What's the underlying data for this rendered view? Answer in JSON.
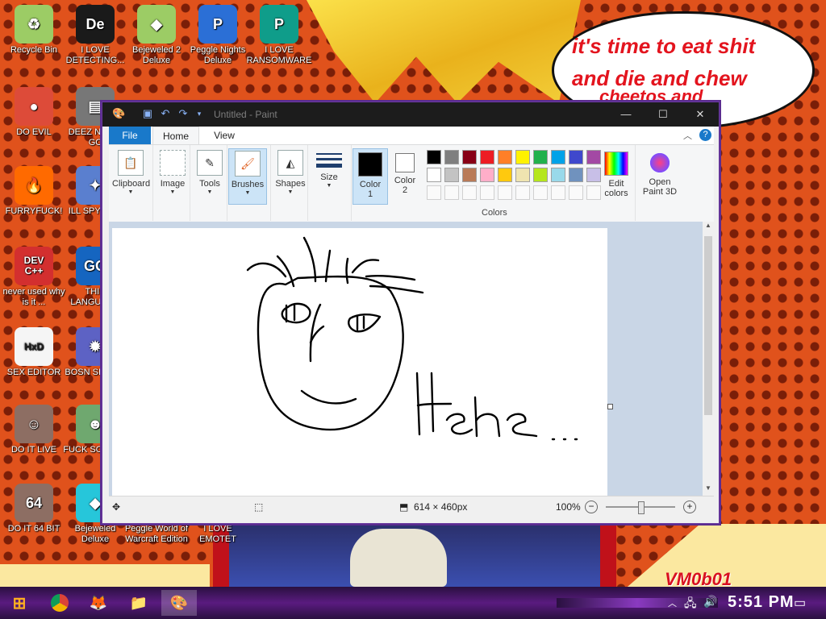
{
  "desktop": {
    "speech_lines": [
      "it's time to eat shit",
      "and die and chew",
      "cheetos and"
    ],
    "watermark": "VM0b01",
    "icons": [
      {
        "label": "Recycle Bin",
        "glyph": "♻",
        "color": "#9ccc65"
      },
      {
        "label": "I LOVE DETECTING...",
        "glyph": "De",
        "color": "#1a1a1a"
      },
      {
        "label": "Bejeweled 2 Deluxe",
        "glyph": "◆",
        "color": "#9ccc65"
      },
      {
        "label": "Peggle Nights Deluxe",
        "glyph": "P",
        "color": "#2b6fd6"
      },
      {
        "label": "I LOVE RANSOMWARE",
        "glyph": "P",
        "color": "#0f9d8a"
      },
      {
        "label": "DO EVIL",
        "glyph": "●",
        "color": "#dd4b39"
      },
      {
        "label": "DEEZ N HAH GC",
        "glyph": "▤",
        "color": "#777777"
      },
      {
        "label": "FURRYFUCK!",
        "glyph": "🔥",
        "color": "#ff6a00"
      },
      {
        "label": "ILL SPY YOU",
        "glyph": "✦",
        "color": "#5a7fcf"
      },
      {
        "label": "never used why is it ...",
        "glyph": "DEV C++",
        "color": "#d32f2f"
      },
      {
        "label": "THIS LANGUAGE",
        "glyph": "GO",
        "color": "#1565c0"
      },
      {
        "label": "SEX EDITOR",
        "glyph": "HxD",
        "color": "#f5f5f5"
      },
      {
        "label": "BOSN SIMULA",
        "glyph": "✹",
        "color": "#5d62c4"
      },
      {
        "label": "DO IT LIVE",
        "glyph": "☺",
        "color": "#8d6e63"
      },
      {
        "label": "FUCK SO ELVE",
        "glyph": "☻",
        "color": "#6fa86f"
      },
      {
        "label": "DO IT 64 BIT",
        "glyph": "64",
        "color": "#8d6e63"
      },
      {
        "label": "Bejeweled Deluxe",
        "glyph": "◆",
        "color": "#26c6da"
      },
      {
        "label": "Peggle World of Warcraft Edition",
        "glyph": "",
        "color": "#c0111a"
      },
      {
        "label": "I LOVE EMOTET",
        "glyph": "",
        "color": "#c0111a"
      }
    ]
  },
  "window": {
    "title": "Untitled - Paint",
    "controls": {
      "minimize": "—",
      "maximize": "☐",
      "close": "✕"
    },
    "menu": {
      "file": "File",
      "home": "Home",
      "view": "View"
    },
    "ribbon": {
      "clipboard": "Clipboard",
      "image": "Image",
      "tools": "Tools",
      "brushes": "Brushes",
      "shapes": "Shapes",
      "size": "Size",
      "color1": [
        "Color",
        "1"
      ],
      "color2": [
        "Color",
        "2"
      ],
      "colors_group": "Colors",
      "edit_colors": [
        "Edit",
        "colors"
      ],
      "paint3d": [
        "Open",
        "Paint 3D"
      ],
      "palette_row1": [
        "#000000",
        "#7f7f7f",
        "#880015",
        "#ed1c24",
        "#ff7f27",
        "#fff200",
        "#22b14c",
        "#00a2e8",
        "#3f48cc",
        "#a349a4"
      ],
      "palette_row2": [
        "#ffffff",
        "#c3c3c3",
        "#b97a57",
        "#ffaec9",
        "#ffc90e",
        "#efe4b0",
        "#b5e61d",
        "#99d9ea",
        "#7092be",
        "#c8bfe7"
      ],
      "color1_value": "#000000",
      "color2_value": "#ffffff"
    },
    "canvas_text": "Hehe...",
    "status": {
      "size": "614 × 460px",
      "zoom": "100%",
      "zoom_level": 0.5
    }
  },
  "taskbar": {
    "time": "5:51 PM"
  }
}
